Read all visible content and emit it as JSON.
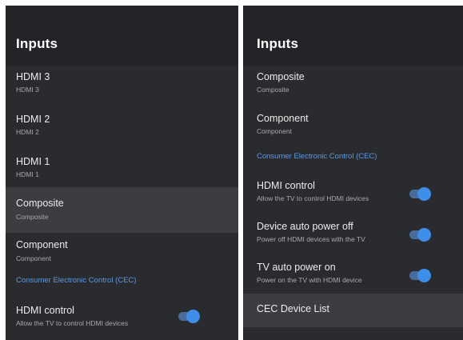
{
  "left_panel": {
    "title": "Inputs",
    "items": [
      {
        "title": "HDMI 3",
        "subtitle": "HDMI 3"
      },
      {
        "title": "HDMI 2",
        "subtitle": "HDMI 2"
      },
      {
        "title": "HDMI 1",
        "subtitle": "HDMI 1"
      },
      {
        "title": "Composite",
        "subtitle": "Composite",
        "selected": true
      },
      {
        "title": "Component",
        "subtitle": "Component"
      }
    ],
    "section_label": "Consumer Electronic Control (CEC)",
    "cec_items": [
      {
        "title": "HDMI control",
        "subtitle": "Allow the TV to control HDMI devices",
        "toggle_on": true
      }
    ]
  },
  "right_panel": {
    "title": "Inputs",
    "items": [
      {
        "title": "Composite",
        "subtitle": "Composite"
      },
      {
        "title": "Component",
        "subtitle": "Component"
      }
    ],
    "section_label": "Consumer Electronic Control (CEC)",
    "cec_items": [
      {
        "title": "HDMI control",
        "subtitle": "Allow the TV to control HDMI devices",
        "toggle_on": true
      },
      {
        "title": "Device auto power off",
        "subtitle": "Power off HDMI devices with the TV",
        "toggle_on": true
      },
      {
        "title": "TV auto power on",
        "subtitle": "Power on the TV with HDMI device",
        "toggle_on": true
      }
    ],
    "cec_device_list": {
      "title": "CEC Device List",
      "selected": true
    }
  },
  "colors": {
    "background": "#2a2b2e",
    "header": "#232427",
    "selected_row": "#3c3d40",
    "accent": "#5b9ae6",
    "toggle_knob": "#3d8ee8"
  }
}
